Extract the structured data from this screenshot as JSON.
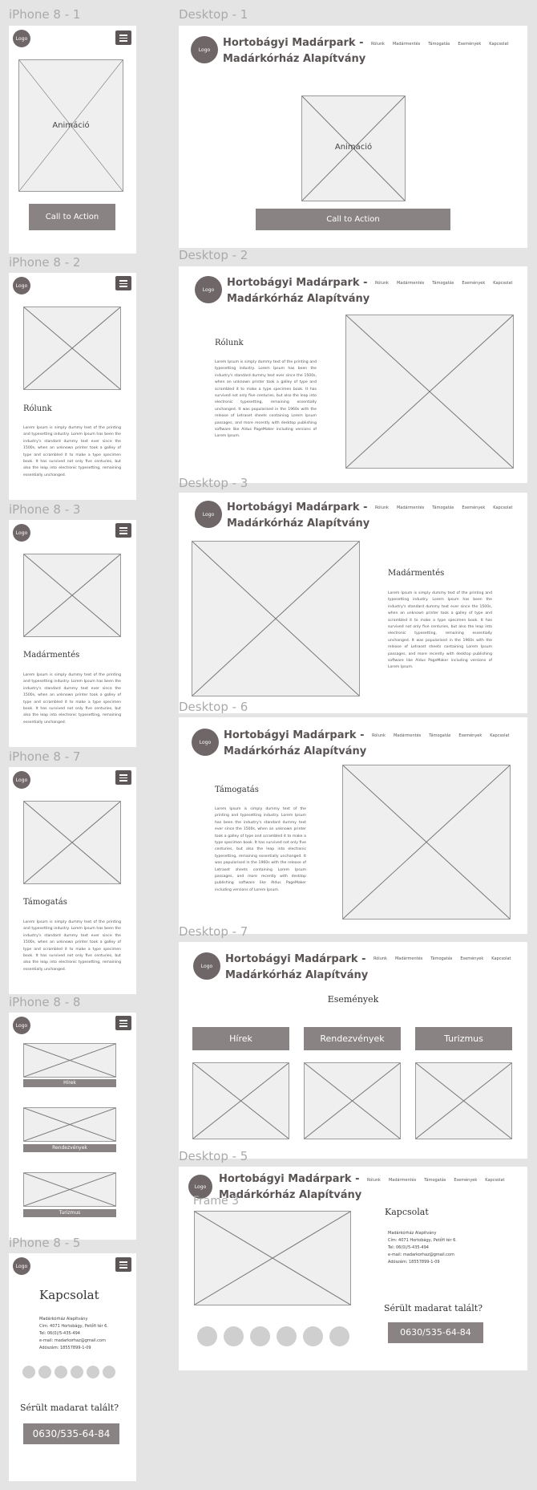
{
  "frame_labels": {
    "m1": "iPhone 8 - 1",
    "m2": "iPhone 8 - 2",
    "m3": "iPhone 8 - 3",
    "m7": "iPhone 8 - 7",
    "m8": "iPhone 8 - 8",
    "m5": "iPhone 8 - 5",
    "d1": "Desktop - 1",
    "d2": "Desktop - 2",
    "d3": "Desktop - 3",
    "d6": "Desktop - 6",
    "d7": "Desktop - 7",
    "d5": "Desktop - 5",
    "frame3": "Frame 3"
  },
  "site": {
    "logo": "Logo",
    "title_line1": "Hortobágyi Madárpark -",
    "title_line2": "Madárkórház Alapítvány",
    "nav": [
      "Rólunk",
      "Madármentés",
      "Támogatás",
      "Események",
      "Kapcsolat"
    ]
  },
  "hero": {
    "animation_label": "Animáció",
    "cta": "Call to Action"
  },
  "sections": {
    "rolunk": "Rólunk",
    "madarmentes": "Madármentés",
    "tamogatas": "Támogatás",
    "esemenyek": "Események",
    "kapcsolat": "Kapcsolat"
  },
  "lorem": "Lorem Ipsum is simply dummy text of the printing and typesetting industry. Lorem Ipsum has been the industry's standard dummy text ever since the 1500s, when an unknown printer took a galley of type and scrambled it to make a type specimen book. It has survived not only five centuries, but also the leap into electronic typesetting, remaining essentially unchanged. It was popularised in the 1960s with the release of Letraset sheets containing Lorem Ipsum passages, and more recently with desktop publishing software like Aldus PageMaker including versions of Lorem Ipsum.",
  "lorem_short": "Lorem Ipsum is simply dummy text of the printing and typesetting industry. Lorem Ipsum has been the industry's standard dummy text ever since the 1500s, when an unknown printer took a galley of type and scrambled it to make a type specimen book. It has survived not only five centuries, but also the leap into electronic typesetting, remaining essentially unchanged.",
  "events": {
    "news": "Hírek",
    "rendezvenyek": "Rendezvények",
    "turizmus": "Turizmus"
  },
  "contact": {
    "name": "Madárkórház Alapítvány",
    "address": "Cím: 4071 Hortobágy, Petőfi tér 6.",
    "phone": "Tel: 06(0)/5-435-494",
    "email": "e-mail: madarkorhaz@gmail.com",
    "tax": "Adószám: 18557899-1-09",
    "injured_prompt": "Sérült madarat talált?",
    "hotline": "0630/535-64-84"
  }
}
